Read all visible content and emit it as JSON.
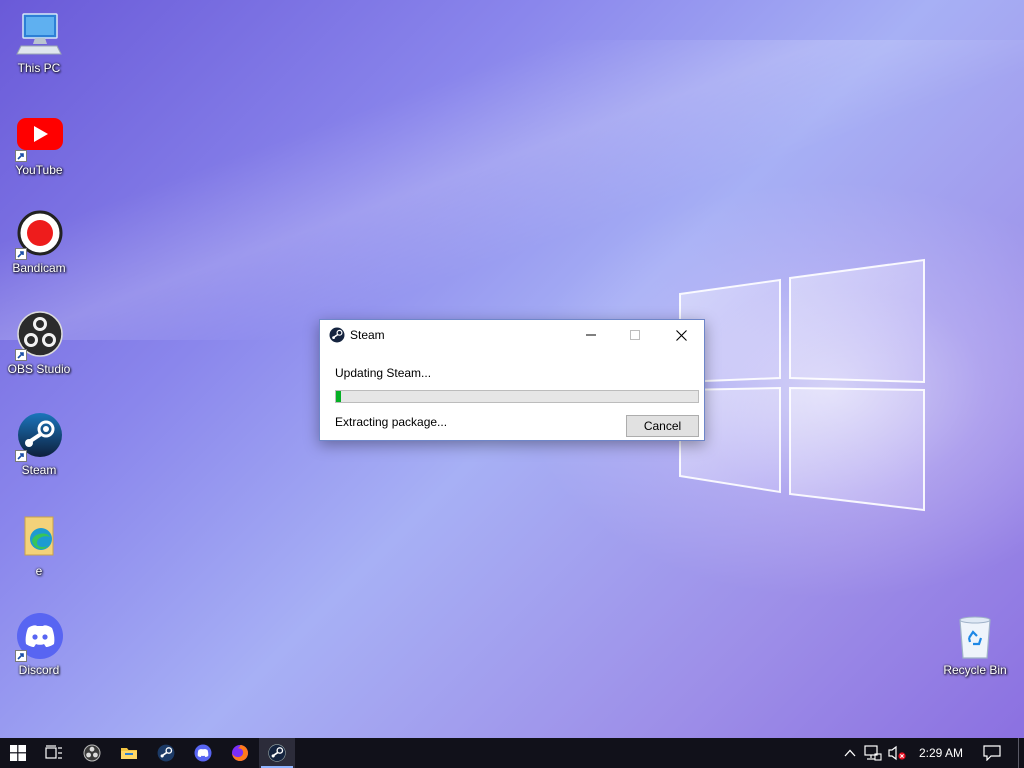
{
  "desktop": {
    "icons": [
      {
        "label": "This PC",
        "icon": "monitor-icon"
      },
      {
        "label": "YouTube",
        "icon": "youtube-icon"
      },
      {
        "label": "Bandicam",
        "icon": "record-icon"
      },
      {
        "label": "OBS Studio",
        "icon": "obs-icon"
      },
      {
        "label": "Steam",
        "icon": "steam-icon"
      },
      {
        "label": "e",
        "icon": "edge-file-icon"
      },
      {
        "label": "Discord",
        "icon": "discord-icon"
      },
      {
        "label": "Recycle Bin",
        "icon": "recycle-bin-icon"
      }
    ]
  },
  "dialog": {
    "title": "Steam",
    "status": "Updating Steam...",
    "progress": 0.015,
    "detail": "Extracting package...",
    "cancel_label": "Cancel"
  },
  "taskbar": {
    "clock": "2:29 AM",
    "accent": "#06b025"
  }
}
